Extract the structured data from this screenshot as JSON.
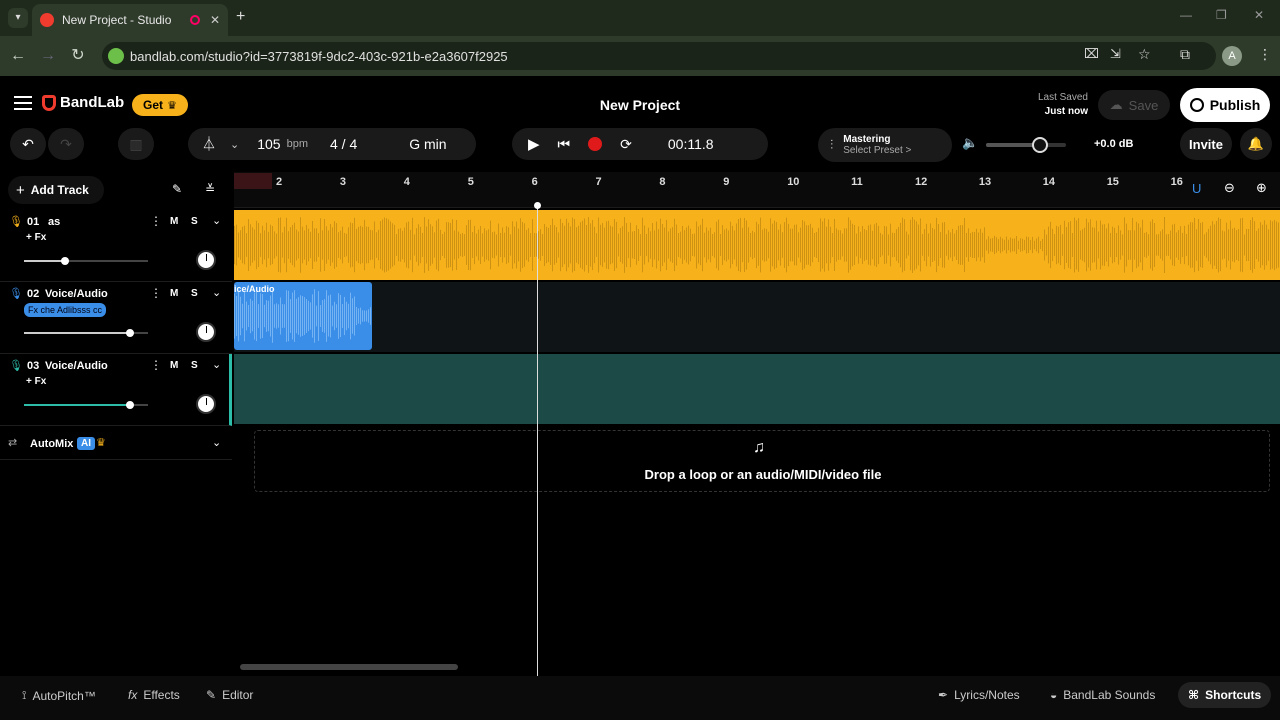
{
  "browser": {
    "tab_title": "New Project - Studio",
    "url": "bandlab.com/studio?id=3773819f-9dc2-403c-921b-e2a3607f2925",
    "profile_initial": "A"
  },
  "header": {
    "brand": "BandLab",
    "get_label": "Get",
    "project_title": "New Project",
    "last_saved_label": "Last Saved",
    "last_saved_value": "Just now",
    "save_label": "Save",
    "publish_label": "Publish"
  },
  "toolbar": {
    "tempo": "105",
    "tempo_unit": "bpm",
    "time_sig": "4 / 4",
    "key": "G min",
    "time": "00:11.8",
    "mastering_label": "Mastering",
    "mastering_preset": "Select Preset >",
    "master_db": "+0.0 dB",
    "invite_label": "Invite"
  },
  "tracklist": {
    "add_track_label": "Add Track",
    "tracks": [
      {
        "num": "01",
        "name": "as",
        "fx": "+ Fx",
        "m": "M",
        "s": "S"
      },
      {
        "num": "02",
        "name": "Voice/Audio",
        "fx": "Fx che Adlibsss cc",
        "m": "M",
        "s": "S"
      },
      {
        "num": "03",
        "name": "Voice/Audio",
        "fx": "+ Fx",
        "m": "M",
        "s": "S"
      }
    ],
    "automix_label": "AutoMix",
    "automix_badge": "AI"
  },
  "ruler": {
    "marks": [
      "2",
      "3",
      "4",
      "5",
      "6",
      "7",
      "8",
      "9",
      "10",
      "11",
      "12",
      "13",
      "14",
      "15",
      "16"
    ]
  },
  "clips": {
    "clip2_label": "ice/Audio"
  },
  "drop_zone": {
    "text": "Drop a loop or an audio/MIDI/video file"
  },
  "bottom": {
    "autopitch": "AutoPitch™",
    "effects": "Effects",
    "editor": "Editor",
    "lyrics": "Lyrics/Notes",
    "sounds": "BandLab Sounds",
    "shortcuts": "Shortcuts"
  },
  "colors": {
    "track1": "#f7b21b",
    "track2": "#3a8ee8",
    "track3": "#1c4a46",
    "record": "#e01a1a",
    "brand_red": "#f03c2e",
    "get_yellow": "#f7b21b"
  }
}
